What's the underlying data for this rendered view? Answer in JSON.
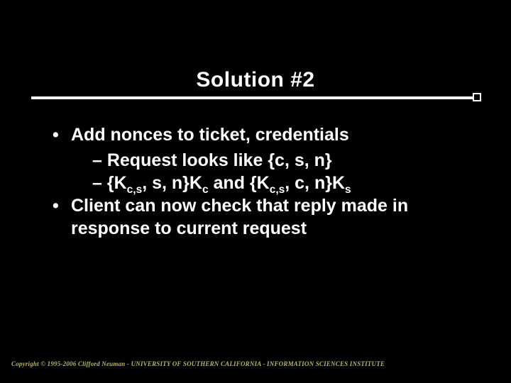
{
  "title": "Solution #2",
  "bullets": {
    "b1": "Add nonces to ticket, credentials",
    "b1a_prefix": "– Request looks like {c, s, n}",
    "b1b": {
      "dash": "– {K",
      "sub1": "c,s",
      "p2": ", s, n}K",
      "sub2": "c",
      "p3": " and {K",
      "sub3": "c,s",
      "p4": ", c, n}K",
      "sub4": "s"
    },
    "b2": "Client can now check that reply made in response to current request"
  },
  "footer": "Copyright © 1995-2006 Clifford Neuman - UNIVERSITY OF SOUTHERN CALIFORNIA - INFORMATION SCIENCES INSTITUTE"
}
